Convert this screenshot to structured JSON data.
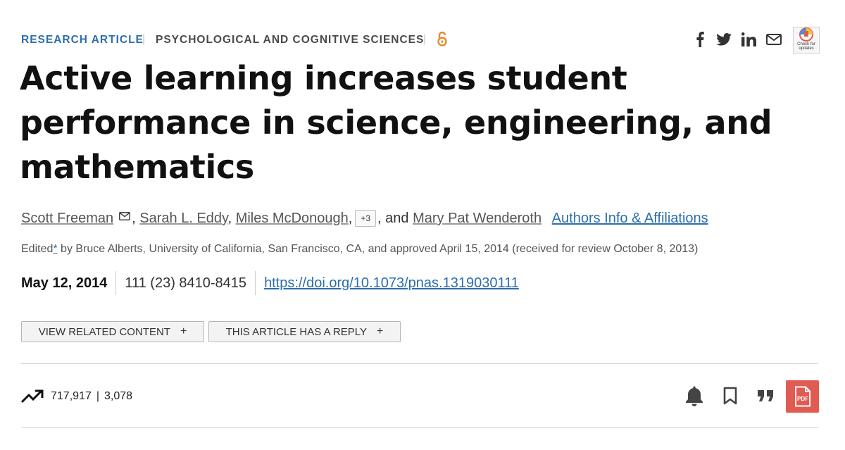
{
  "header": {
    "category_primary": "RESEARCH ARTICLE",
    "separator": "|",
    "category_secondary": "PSYCHOLOGICAL AND COGNITIVE SCIENCES",
    "open_access_icon": "open-access-icon",
    "share_icons": [
      "facebook-icon",
      "twitter-icon",
      "linkedin-icon",
      "email-icon"
    ],
    "check_updates_label": "Check for updates"
  },
  "article": {
    "title": "Active learning increases student performance in science, engineering, and mathematics",
    "authors": [
      "Scott Freeman",
      "Sarah L. Eddy",
      "Miles McDonough"
    ],
    "more_authors": "+3",
    "and_text": ", and",
    "last_author": "Mary Pat Wenderoth",
    "affiliations_link": "Authors Info & Affiliations",
    "edited_prefix": "Edited",
    "edited_marker": "*",
    "edited_text": " by Bruce Alberts, University of California, San Francisco, CA, and approved April 15, 2014 (received for review October 8, 2013)",
    "date": "May 12, 2014",
    "volume": "111 (23) 8410-8415",
    "doi": "https://doi.org/10.1073/pnas.1319030111"
  },
  "buttons": {
    "related": "VIEW RELATED CONTENT",
    "reply": "THIS ARTICLE HAS A REPLY",
    "plus": "+"
  },
  "metrics": {
    "icon": "trending-up-icon",
    "views": "717,917",
    "separator": "|",
    "citations": "3,078"
  },
  "actions": [
    "bell-icon",
    "bookmark-icon",
    "quote-icon",
    "pdf-icon"
  ],
  "colors": {
    "link_blue": "#2d6ead",
    "pdf_red": "#e05c53",
    "open_access_orange": "#e88a2d"
  }
}
